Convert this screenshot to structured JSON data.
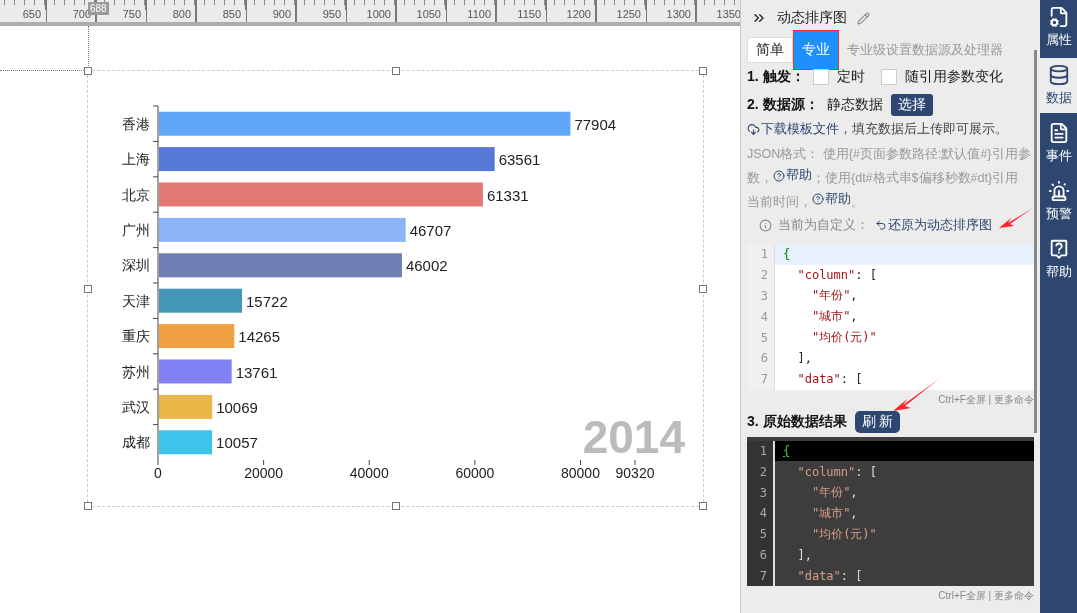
{
  "ruler": {
    "labels": [
      "650",
      "700",
      "750",
      "800",
      "850",
      "900",
      "950",
      "1000",
      "1050",
      "1100",
      "1150",
      "1200",
      "1250",
      "1300",
      "1350"
    ],
    "guide_badge": "688"
  },
  "chart": {
    "chart_data": {
      "type": "bar",
      "orientation": "horizontal",
      "categories": [
        "香港",
        "上海",
        "北京",
        "广州",
        "深圳",
        "天津",
        "重庆",
        "苏州",
        "武汉",
        "成都"
      ],
      "values": [
        77904,
        63561,
        61331,
        46707,
        46002,
        15722,
        14265,
        13761,
        10069,
        10057
      ],
      "xlim": [
        0,
        90320
      ],
      "xticks": [
        0,
        20000,
        40000,
        60000,
        80000,
        90320
      ],
      "data_labels": true
    },
    "bars": [
      {
        "color": "#60a7f8"
      },
      {
        "color": "#5878d8"
      },
      {
        "color": "#e27873"
      },
      {
        "color": "#8bb3f8"
      },
      {
        "color": "#6f7fb3"
      },
      {
        "color": "#4298b5"
      },
      {
        "color": "#f0a040"
      },
      {
        "color": "#8282f5"
      },
      {
        "color": "#e9b648"
      },
      {
        "color": "#3fc4ec"
      }
    ],
    "year_label": "2014"
  },
  "panel": {
    "title": "动态排序图",
    "tabs": [
      {
        "label": "简单",
        "selected": false
      },
      {
        "label": "专业",
        "selected": true
      }
    ],
    "tab_hint": "专业级设置数据源及处理器",
    "trigger": {
      "label": "1. 触发：",
      "options": [
        {
          "label": "定时",
          "checked": false
        },
        {
          "label": "随引用参数变化",
          "checked": false
        }
      ]
    },
    "source": {
      "label": "2. 数据源：",
      "value": "静态数据",
      "button": "选择"
    },
    "download": {
      "link": "下载模板文件",
      "text": "，填充数据后上传即可展示。"
    },
    "help_paragraph": [
      {
        "kind": "text",
        "text": "JSON格式：  使用{#页面参数路径:默认值#}引用参数，"
      },
      {
        "kind": "link",
        "text": "帮助"
      },
      {
        "kind": "text",
        "text": "；使用{dt#格式串$偏移秒数#dt}引用当前时间，"
      },
      {
        "kind": "link",
        "text": "帮助"
      },
      {
        "kind": "text",
        "text": "。"
      }
    ],
    "custom_note": {
      "text": "当前为自定义：",
      "link": "还原为动态排序图"
    },
    "editors": [
      {
        "kind": "light",
        "lines": [
          {
            "number": "1",
            "text": "{",
            "active": true
          },
          {
            "number": "2",
            "text": "  \"column\": [",
            "active": false
          },
          {
            "number": "3",
            "text": "    \"年份\",",
            "active": false
          },
          {
            "number": "4",
            "text": "    \"城市\",",
            "active": false
          },
          {
            "number": "5",
            "text": "    \"均价(元)\"",
            "active": false
          },
          {
            "number": "6",
            "text": "  ],",
            "active": false
          },
          {
            "number": "7",
            "text": "  \"data\": [",
            "active": false
          }
        ],
        "footer": "Ctrl+F全屏 | 更多命令"
      },
      {
        "kind": "dark",
        "lines": [
          {
            "number": "1",
            "text": "{",
            "active": true
          },
          {
            "number": "2",
            "text": "  \"column\": [",
            "active": false
          },
          {
            "number": "3",
            "text": "    \"年份\",",
            "active": false
          },
          {
            "number": "4",
            "text": "    \"城市\",",
            "active": false
          },
          {
            "number": "5",
            "text": "    \"均价(元)\"",
            "active": false
          },
          {
            "number": "6",
            "text": "  ],",
            "active": false
          },
          {
            "number": "7",
            "text": "  \"data\": [",
            "active": false
          }
        ],
        "footer": "Ctrl+F全屏 | 更多命令"
      }
    ],
    "result": {
      "label": "3. 原始数据结果",
      "button": "刷 新"
    }
  },
  "sidebar": [
    {
      "kind": "properties",
      "label": "属性",
      "selected": false
    },
    {
      "kind": "data",
      "label": "数据",
      "selected": true
    },
    {
      "kind": "events",
      "label": "事件",
      "selected": false
    },
    {
      "kind": "alert",
      "label": "预警",
      "selected": false
    },
    {
      "kind": "help",
      "label": "帮助",
      "selected": false
    }
  ]
}
